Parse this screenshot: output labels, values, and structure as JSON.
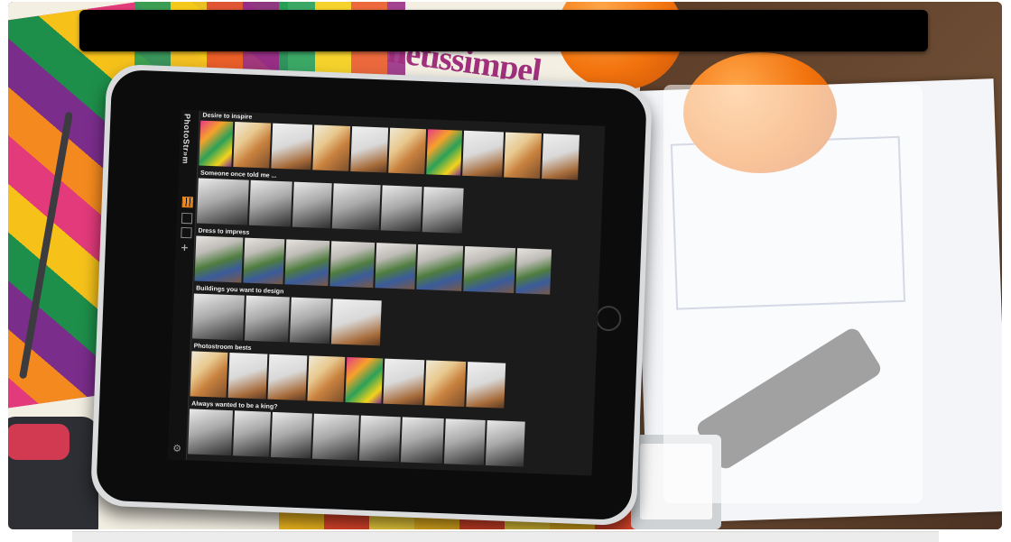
{
  "slide": {
    "title_text": "",
    "caption_text": ""
  },
  "photo": {
    "poster_text": "hetissimpel"
  },
  "app": {
    "brand": "PhotoStr»m",
    "rows": [
      {
        "label": "Desire to inspire"
      },
      {
        "label": "Someone once told me ..."
      },
      {
        "label": "Dress to impress"
      },
      {
        "label": "Buildings you want to design"
      },
      {
        "label": "Photostroom bests"
      },
      {
        "label": "Always wanted to be a king?"
      }
    ],
    "sidebar": {
      "icons": [
        "grid-view-icon",
        "list-view-icon",
        "stack-view-icon",
        "add-icon"
      ],
      "settings_icon": "gear-icon",
      "accent_color": "#f08a1c"
    }
  }
}
